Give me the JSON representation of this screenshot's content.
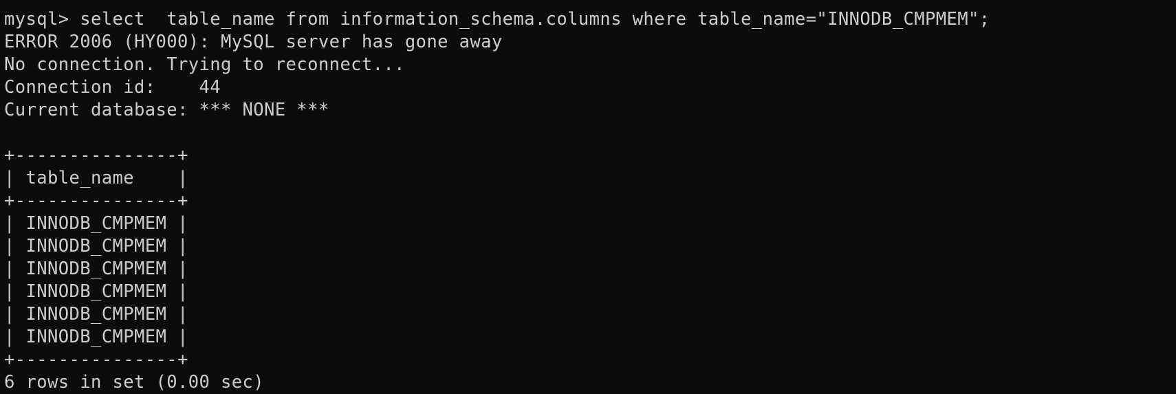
{
  "terminal": {
    "colors": {
      "background": "#0c0c0c",
      "foreground": "#cccccc"
    },
    "lines": [
      "mysql> select  table_name from information_schema.columns where table_name=\"INNODB_CMPMEM\";",
      "ERROR 2006 (HY000): MySQL server has gone away",
      "No connection. Trying to reconnect...",
      "Connection id:    44",
      "Current database: *** NONE ***",
      "",
      "+---------------+",
      "| table_name    |",
      "+---------------+",
      "| INNODB_CMPMEM |",
      "| INNODB_CMPMEM |",
      "| INNODB_CMPMEM |",
      "| INNODB_CMPMEM |",
      "| INNODB_CMPMEM |",
      "| INNODB_CMPMEM |",
      "+---------------+",
      "6 rows in set (0.00 sec)"
    ]
  }
}
